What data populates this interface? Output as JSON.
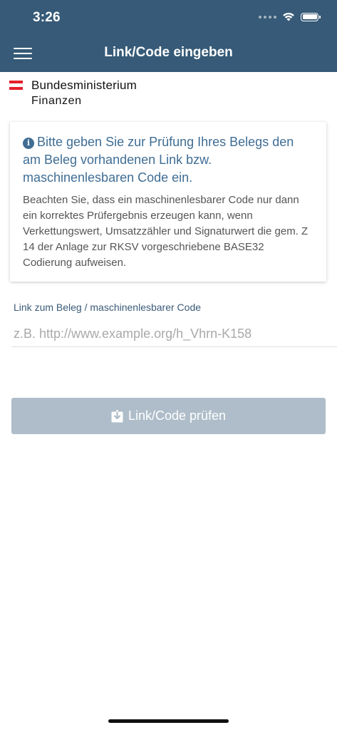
{
  "status_bar": {
    "time": "3:26"
  },
  "header": {
    "title": "Link/Code eingeben",
    "background_color": "#365a77",
    "menu_icon": "hamburger-menu-icon"
  },
  "logo": {
    "line1": "Bundesministerium",
    "line2": "Finanzen",
    "flag_colors": [
      "#e4202c",
      "#ffffff",
      "#e4202c"
    ]
  },
  "info_card": {
    "icon": "info-icon",
    "icon_glyph": "i",
    "heading": "Bitte geben Sie zur Prüfung Ihres Belegs den am Beleg vorhandenen Link bzw. maschinenlesbaren Code ein.",
    "body": "Beachten Sie, dass ein maschinenlesbarer Code nur dann ein korrektes Prüfergebnis erzeugen kann, wenn Verkettungswert, Umsatzzähler und Signaturwert die gem. Z 14 der Anlage zur RKSV vorgeschriebene BASE32 Codierung aufweisen.",
    "accent_color": "#3f6d94"
  },
  "link_field": {
    "label": "Link zum Beleg / maschinenlesbarer Code",
    "value": "",
    "placeholder": "z.B. http://www.example.org/h_Vhrn-K158"
  },
  "check_button": {
    "label": "Link/Code prüfen",
    "icon": "download-box-icon",
    "color": "#aebdc9"
  }
}
